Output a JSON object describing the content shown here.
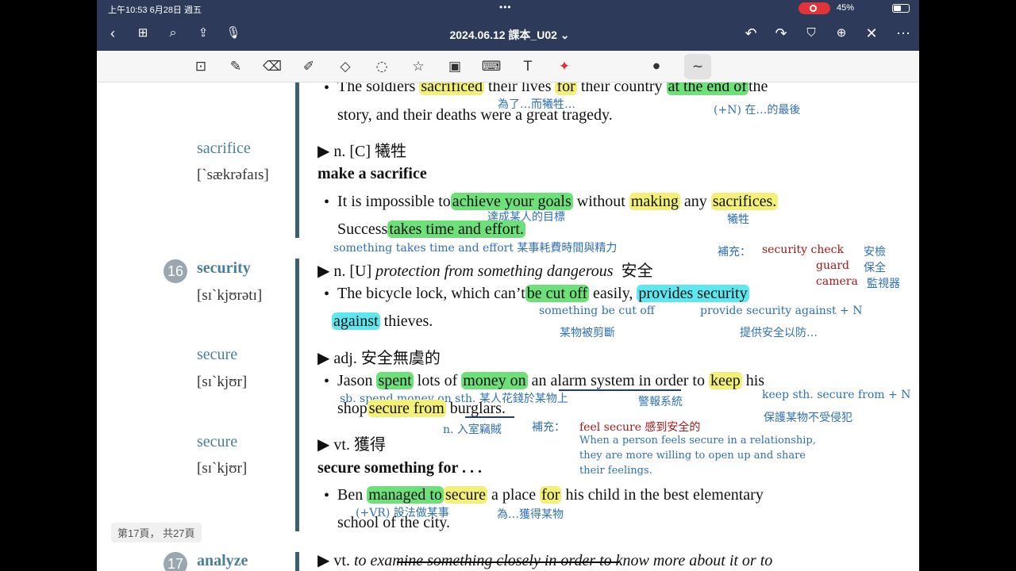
{
  "status": {
    "time": "上午10:53  6月28日 週五",
    "dots": "•••",
    "battery": "45%"
  },
  "nav": {
    "title": "2024.06.12 課本_U02 ⌄"
  },
  "page_indicator": "第17頁， 共27頁",
  "entries": {
    "s1": "The soldiers",
    "s1_hl1": "sacrificed",
    "s1_mid": "their lives",
    "s1_hl2": "for",
    "s1_mid2": "their country",
    "s1_hl3": "at the end of",
    "s1_end": "the",
    "s1_l2": "story, and their deaths were a great tragedy.",
    "sacrifice_word": "sacrifice",
    "sacrifice_pron": "[`sækrəfaɪs]",
    "sacrifice_pos": "▶ n. [C] 犧牲",
    "make_sacrifice": "make a sacrifice",
    "s2_a": "It is impossible to",
    "s2_hl1": "achieve your goals",
    "s2_b": "without",
    "s2_hl2": "making",
    "s2_c": "any",
    "s2_hl3": "sacrifices.",
    "s3_a": "Success",
    "s3_hl": "takes time and effort.",
    "security_num": "16",
    "security_word": "security",
    "security_pron": "[sɪ`kjʊrətɪ]",
    "security_pos_a": "▶ n. [U]",
    "security_pos_b": "protection from something dangerous",
    "security_pos_c": "安全",
    "s4_a": "The bicycle lock, which can’t",
    "s4_hl1": "be cut off",
    "s4_b": "easily,",
    "s4_hl2": "provides security",
    "s4_hl3": "against",
    "s4_c": "thieves.",
    "secure1_word": "secure",
    "secure1_pron": "[sɪ`kjʊr]",
    "secure1_pos": "▶ adj. 安全無虞的",
    "s5_a": "Jason",
    "s5_hl1": "spent",
    "s5_b": "lots of",
    "s5_hl2": "money on",
    "s5_c": "an alarm system",
    "s5_d": "in order to",
    "s5_hl3": "keep",
    "s5_e": "his",
    "s5_f": "shop",
    "s5_hl4": "secure from",
    "s5_g": "burglars.",
    "secure2_word": "secure",
    "secure2_pron": "[sɪ`kjʊr]",
    "secure2_pos": "▶ vt. 獲得",
    "secure_for": "secure something for . . .",
    "s6_a": "Ben",
    "s6_hl1": "managed to",
    "s6_hl2": "secure",
    "s6_b": "a place",
    "s6_hl3": "for",
    "s6_c": "his child in the best elementary",
    "s6_l2": "school of the city.",
    "analyze_num": "17",
    "analyze_word": "analyze",
    "analyze_pos_a": "▶ vt.",
    "analyze_pos_b": "to examine something closely in order to know more about it or to"
  },
  "notes": {
    "n1": "為了…而犧牲…",
    "n2": "(+N) 在…的最後",
    "n3": "達成某人的目標",
    "n4": "犧牲",
    "n5": "something takes time and effort 某事耗費時間與精力",
    "n6": "補充：",
    "n6b": "security check",
    "n6c": "安檢",
    "n7": "guard",
    "n7b": "保全",
    "n8": "camera",
    "n8b": "監視器",
    "n9": "something be cut off",
    "n10": "某物被剪斷",
    "n11": "provide security against + N",
    "n12": "提供安全以防…",
    "n13": "sb. spend money on sth. 某人花錢於某物上",
    "n14": "警報系統",
    "n15": "keep sth. secure from + N",
    "n16": "保護某物不受侵犯",
    "n17": "n. 入室竊賊",
    "n18": "補充：",
    "n18b": "feel secure 感到安全的",
    "n19": "When a person feels secure in a relationship,",
    "n20": "they are more willing to open up and share",
    "n21": "their feelings.",
    "n22": "(+VR) 設法做某事",
    "n23": "為…獲得某物"
  }
}
